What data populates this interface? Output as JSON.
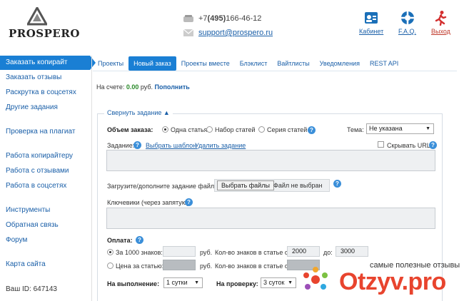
{
  "header": {
    "logo_text": "PROSPERO",
    "phone_prefix": "+7 ",
    "phone_code": "(495)",
    "phone_number": " 166-46-12",
    "email": "support@prospero.ru",
    "nav": [
      {
        "label": "Кабинет",
        "icon": "user-card-icon"
      },
      {
        "label": "F.A.Q.",
        "icon": "lifebuoy-icon"
      },
      {
        "label": "Выход",
        "icon": "running-man-icon"
      }
    ]
  },
  "sidebar": {
    "items": [
      {
        "label": "Заказать копирайт",
        "active": true
      },
      {
        "label": "Заказать отзывы"
      },
      {
        "label": "Раскрутка в соцсетях"
      },
      {
        "label": "Другие задания"
      },
      {
        "label": "Проверка на плагиат"
      },
      {
        "label": "Работа копирайтеру"
      },
      {
        "label": "Работа с отзывами"
      },
      {
        "label": "Работа в соцсетях"
      },
      {
        "label": "Инструменты"
      },
      {
        "label": "Обратная связь"
      },
      {
        "label": "Форум"
      },
      {
        "label": "Карта сайта"
      }
    ],
    "user_id": "Ваш ID: 647143"
  },
  "tabs": [
    {
      "label": "Проекты"
    },
    {
      "label": "Новый заказ",
      "active": true
    },
    {
      "label": "Проекты вместе"
    },
    {
      "label": "Блэклист"
    },
    {
      "label": "Вайтлисты"
    },
    {
      "label": "Уведомления"
    },
    {
      "label": "REST API"
    }
  ],
  "balance": {
    "label": "На счете: ",
    "amount": "0.00",
    "currency": " руб. ",
    "topup": "Пополнить"
  },
  "form": {
    "collapse_label": "Свернуть задание ▲",
    "volume_label": "Объем заказа:",
    "volume_options": [
      "Одна статья",
      "Набор статей",
      "Серия статей"
    ],
    "theme_label": "Тема:",
    "theme_value": "Не указана",
    "task_label": "Задание:",
    "choose_template": "Выбрать шаблон",
    "delete_task": "Удалить задание",
    "hide_url": "Скрывать URL",
    "upload_label": "Загрузите/дополните задание файлом:",
    "file_button": "Выбрать файлы",
    "file_none": "Файл не выбран",
    "keywords_label": "Ключевики (через запятую):",
    "payment_label": "Оплата:",
    "per_1000_label": "За 1000 знаков:",
    "per_article_label": "Цена за статью:",
    "currency": "руб.",
    "chars_label": "Кол-во знаков в статье от:",
    "chars_label2": "Кол-во знаков в статье от:",
    "chars_to": "до:",
    "chars_from_value": "2000",
    "chars_to_value": "3000",
    "exec_label": "На выполнение:",
    "exec_value": "1 сутки",
    "check_label": "На проверку:",
    "check_value": "3 суток"
  },
  "watermark": {
    "small": "самые полезные отзывы",
    "big": "Otzyv.pro"
  },
  "colors": {
    "accent": "#1a7fd4",
    "link": "#1a5fa8",
    "amount": "#2a8a2a",
    "watermark": "#e8442e"
  }
}
